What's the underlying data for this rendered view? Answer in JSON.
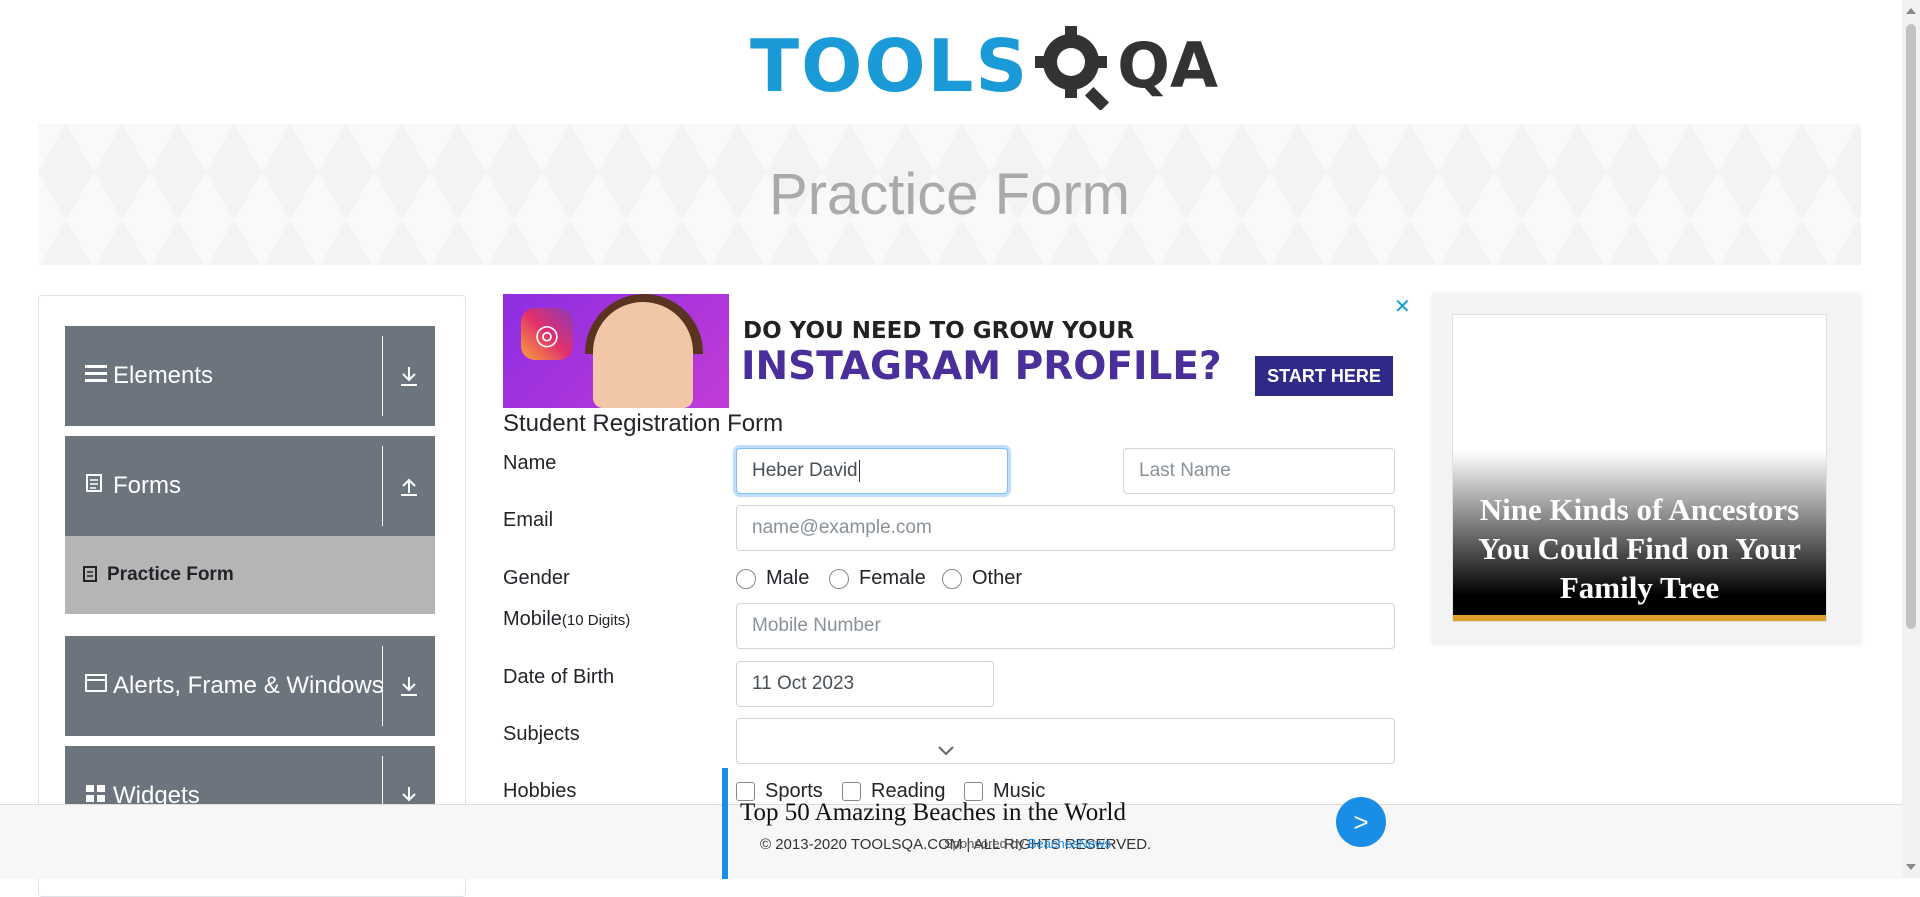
{
  "logo": {
    "text": "TOOLS",
    "qa": "QA"
  },
  "banner": {
    "title": "Practice Form"
  },
  "sidebar": {
    "groups": [
      {
        "label": "Elements",
        "icon": "list-icon",
        "toggle": "download-icon"
      },
      {
        "label": "Forms",
        "icon": "document-icon",
        "toggle": "upload-icon"
      },
      {
        "label": "Alerts, Frame & Windows",
        "icon": "window-icon",
        "toggle": "download-icon"
      },
      {
        "label": "Widgets",
        "icon": "widgets-icon",
        "toggle": "download-icon"
      }
    ],
    "active_item": {
      "label": "Practice Form"
    }
  },
  "ad_top": {
    "line1": "DO YOU NEED TO GROW YOUR",
    "line2": "INSTAGRAM PROFILE?",
    "button": "START HERE",
    "close": "✕"
  },
  "form": {
    "title": "Student Registration Form",
    "name_label": "Name",
    "first_name_value": "Heber David",
    "last_name_placeholder": "Last Name",
    "email_label": "Email",
    "email_placeholder": "name@example.com",
    "gender_label": "Gender",
    "gender_options": [
      "Male",
      "Female",
      "Other"
    ],
    "mobile_label": "Mobile",
    "mobile_hint": "(10 Digits)",
    "mobile_placeholder": "Mobile Number",
    "dob_label": "Date of Birth",
    "dob_value": "11 Oct 2023",
    "subjects_label": "Subjects",
    "hobbies_label": "Hobbies",
    "hobbies_options": [
      "Sports",
      "Reading",
      "Music"
    ]
  },
  "ad_right": {
    "headline": "Nine Kinds of Ancestors You Could Find on Your Family Tree"
  },
  "bottom_ad": {
    "title": "Top 50 Amazing Beaches in the World",
    "footer": "© 2013-2020 TOOLSQA.COM | ALL RIGHTS RESERVED.",
    "sponsor_prefix": "Sponsored by",
    "sponsor": "BeachesNews",
    "go": ">"
  },
  "colors": {
    "brand_blue": "#1a9ad6",
    "sidebar_gray": "#6c757d",
    "active_gray": "#b5b5b5"
  }
}
